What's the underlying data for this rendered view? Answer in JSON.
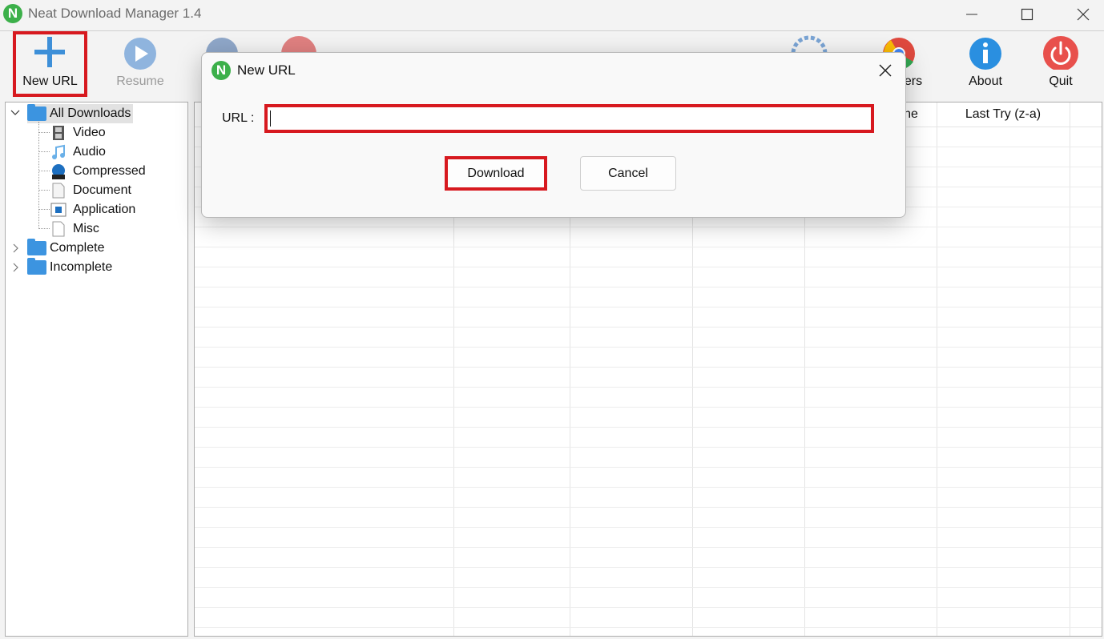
{
  "window": {
    "title": "Neat Download Manager 1.4",
    "logo_letter": "N"
  },
  "toolbar": {
    "new_url": "New URL",
    "resume": "Resume",
    "browsers": "sers",
    "about": "About",
    "quit": "Quit"
  },
  "sidebar": {
    "all_downloads": "All Downloads",
    "children": [
      "Video",
      "Audio",
      "Compressed",
      "Document",
      "Application",
      "Misc"
    ],
    "complete": "Complete",
    "incomplete": "Incomplete"
  },
  "list": {
    "headers": {
      "partial_time": "ne",
      "last_try": "Last Try (z-a)"
    }
  },
  "dialog": {
    "title": "New URL",
    "logo_letter": "N",
    "url_label": "URL :",
    "url_value": "",
    "download_label": "Download",
    "cancel_label": "Cancel"
  },
  "colors": {
    "highlight": "#d7191f",
    "brand": "#3cb04a",
    "folder": "#3c94e0"
  }
}
